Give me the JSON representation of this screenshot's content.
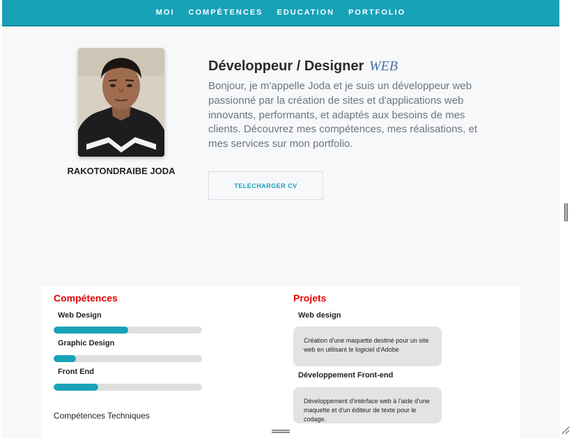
{
  "nav": {
    "items": [
      "MOI",
      "COMPÉTENCES",
      "EDUCATION",
      "PORTFOLIO"
    ],
    "background": "#17a2b8"
  },
  "profile": {
    "name": "RAKOTONDRAIBE JODA",
    "headline": "Développeur / Designer",
    "headline_accent": "WEB",
    "intro": "Bonjour, je m'appelle Joda et je suis un développeur web passionné par la création de sites et d'applications web innovants, performants, et adaptés aux besoins de mes clients. Découvrez mes compétences, mes réalisations, et mes services sur mon portfolio.",
    "cv_button": "TELECHARGER CV"
  },
  "skills": {
    "title": "Compétences",
    "items": [
      {
        "label": "Web Design",
        "level": 0.5
      },
      {
        "label": "Graphic Design",
        "level": 0.15
      },
      {
        "label": "Front End",
        "level": 0.3
      }
    ],
    "technical_title": "Compétences Techniques"
  },
  "projects": {
    "title": "Projets",
    "items": [
      {
        "title": "Web design",
        "description": "Création d'une maquette destiné pour un site web en utilisant le logiciel d'Adobe"
      },
      {
        "title": "Développement Front-end",
        "description": "Développement d'intérface web à l'aide d'une maquette et d'un éditeur de texte pour le codage."
      }
    ]
  },
  "colors": {
    "accent": "#17a2b8",
    "section_title": "#e00000",
    "headline_accent": "#4a6fa5"
  }
}
